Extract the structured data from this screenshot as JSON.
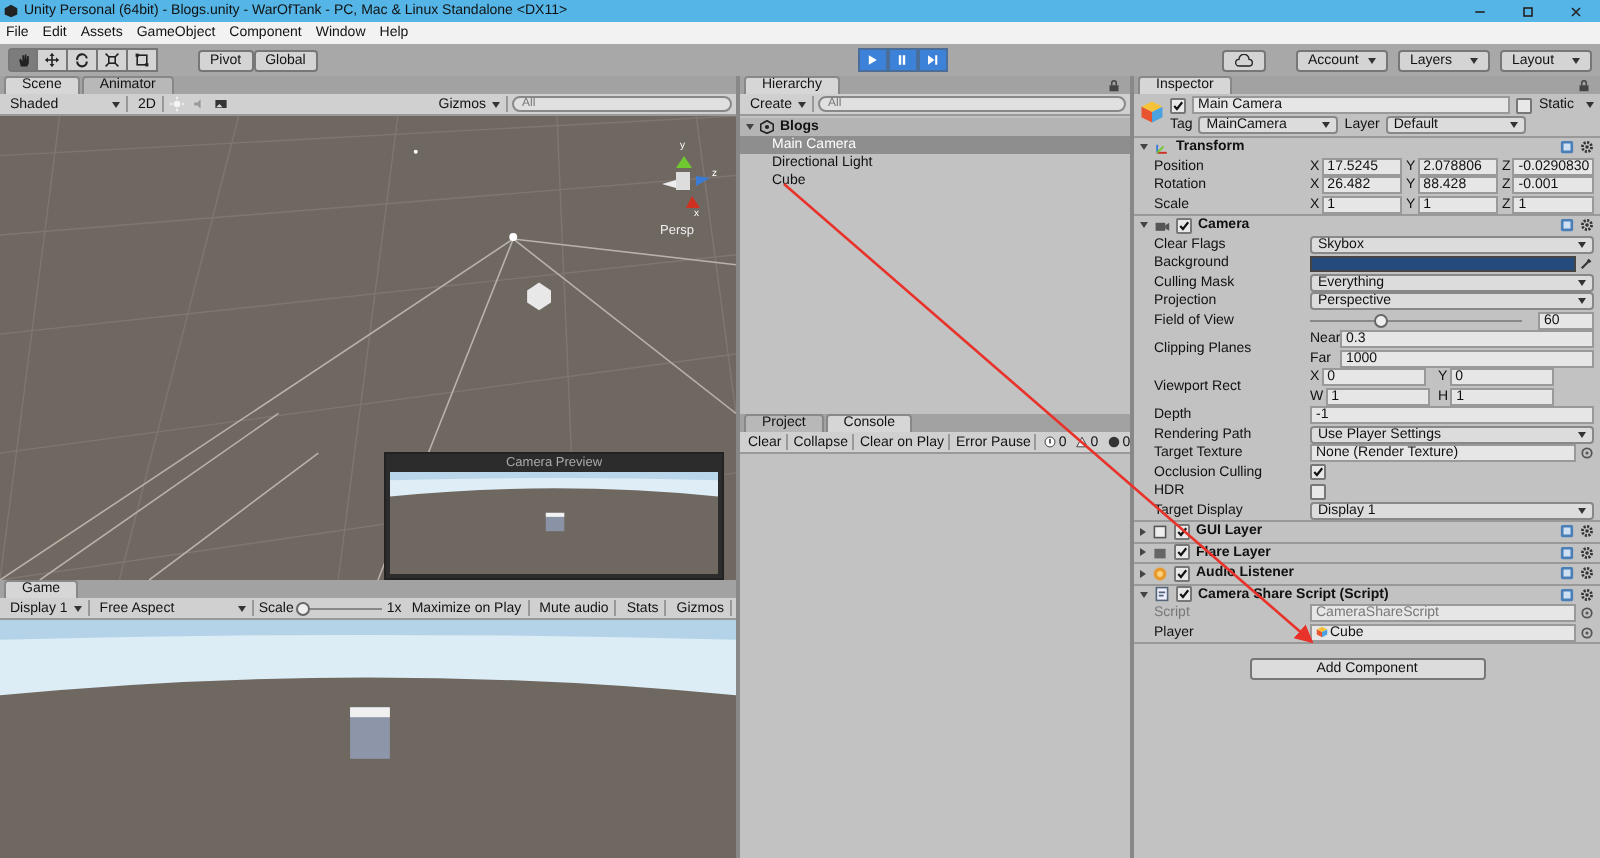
{
  "window": {
    "title": "Unity Personal (64bit) - Blogs.unity - WarOfTank - PC, Mac & Linux Standalone <DX11>"
  },
  "menu": [
    "File",
    "Edit",
    "Assets",
    "GameObject",
    "Component",
    "Window",
    "Help"
  ],
  "toolbar": {
    "tools": [
      {
        "kind": "hand",
        "selected": true
      },
      {
        "kind": "move",
        "selected": false
      },
      {
        "kind": "rotate",
        "selected": false
      },
      {
        "kind": "scale",
        "selected": false
      },
      {
        "kind": "rect",
        "selected": false
      }
    ],
    "pivot": "Pivot",
    "space": "Global",
    "playback": [
      {
        "kind": "play",
        "on": true
      },
      {
        "kind": "pause",
        "on": true
      },
      {
        "kind": "step",
        "on": true
      }
    ],
    "account": "Account",
    "layers": "Layers",
    "layout": "Layout"
  },
  "scene": {
    "tabs": [
      {
        "label": "Scene",
        "selected": true
      },
      {
        "label": "Animator",
        "selected": false
      }
    ],
    "shading": "Shaded",
    "mode_2d": "2D",
    "gizmos": "Gizmos",
    "search_placeholder": "All",
    "axes": [
      "y",
      "z",
      "x"
    ],
    "projection": "Persp",
    "camera_preview": {
      "title": "Camera Preview"
    }
  },
  "game": {
    "tab": "Game",
    "display": "Display 1",
    "aspect": "Free Aspect",
    "scale_label": "Scale",
    "scale": {
      "level": 0
    },
    "scale_reading": "1x",
    "buttons": [
      "Maximize on Play",
      "Mute audio",
      "Stats",
      "Gizmos"
    ]
  },
  "hierarchy": {
    "tab": "Hierarchy",
    "create": "Create",
    "search_placeholder": "All",
    "tree": [
      {
        "label": "Blogs",
        "expanded": true,
        "selected": false,
        "children": [
          {
            "label": "Main Camera",
            "selected": true
          },
          {
            "label": "Directional Light",
            "selected": false
          },
          {
            "label": "Cube",
            "selected": false
          }
        ]
      }
    ]
  },
  "console": {
    "tabs": [
      {
        "label": "Project",
        "selected": false
      },
      {
        "label": "Console",
        "selected": true
      }
    ],
    "buttons": [
      "Clear",
      "Collapse",
      "Clear on Play",
      "Error Pause"
    ],
    "counts": [
      {
        "kind": "info",
        "count": "0"
      },
      {
        "kind": "warning",
        "count": "0"
      },
      {
        "kind": "error",
        "count": "0"
      }
    ]
  },
  "inspector": {
    "tab": "Inspector",
    "active": true,
    "name": "Main Camera",
    "static_label": "Static",
    "static": false,
    "tag_label": "Tag",
    "tag": "MainCamera",
    "layer_label": "Layer",
    "layer": "Default",
    "components": [
      {
        "name": "Transform",
        "kind": "transform",
        "expanded": true,
        "rows": [
          {
            "kind": "vector",
            "label": "Position",
            "values": [
              {
                "axis": "X",
                "value": "17.5245"
              },
              {
                "axis": "Y",
                "value": "2.078806"
              },
              {
                "axis": "Z",
                "value": "-0.0290830"
              }
            ]
          },
          {
            "kind": "vector",
            "label": "Rotation",
            "values": [
              {
                "axis": "X",
                "value": "26.482"
              },
              {
                "axis": "Y",
                "value": "88.428"
              },
              {
                "axis": "Z",
                "value": "-0.001"
              }
            ]
          },
          {
            "kind": "vector",
            "label": "Scale",
            "values": [
              {
                "axis": "X",
                "value": "1"
              },
              {
                "axis": "Y",
                "value": "1"
              },
              {
                "axis": "Z",
                "value": "1"
              }
            ]
          }
        ]
      },
      {
        "name": "Camera",
        "kind": "camera",
        "enabled": true,
        "expanded": true,
        "rows": [
          {
            "kind": "dropdown",
            "label": "Clear Flags",
            "value": "Skybox"
          },
          {
            "kind": "color",
            "label": "Background",
            "color": "#254a7e"
          },
          {
            "kind": "dropdown",
            "label": "Culling Mask",
            "value": "Everything"
          },
          {
            "kind": "dropdown",
            "label": "Projection",
            "value": "Perspective"
          },
          {
            "kind": "slider",
            "label": "Field of View",
            "level": 0.33,
            "value": "60"
          },
          {
            "kind": "stacked",
            "label": "Clipping Planes",
            "values": [
              {
                "axis": "Near",
                "value": "0.3"
              },
              {
                "axis": "Far",
                "value": "1000"
              }
            ]
          },
          {
            "kind": "grid",
            "label": "Viewport Rect",
            "values": [
              {
                "axis": "X",
                "value": "0"
              },
              {
                "axis": "Y",
                "value": "0"
              },
              {
                "axis": "W",
                "value": "1"
              },
              {
                "axis": "H",
                "value": "1"
              }
            ]
          },
          {
            "kind": "text",
            "label": "Depth",
            "value": "-1"
          },
          {
            "kind": "dropdown",
            "label": "Rendering Path",
            "value": "Use Player Settings"
          },
          {
            "kind": "object",
            "label": "Target Texture",
            "value": "None (Render Texture)",
            "disabled": false,
            "has_icon": false
          },
          {
            "kind": "checkbox",
            "label": "Occlusion Culling",
            "checked": true
          },
          {
            "kind": "checkbox",
            "label": "HDR",
            "checked": false
          },
          {
            "kind": "dropdown",
            "label": "Target Display",
            "value": "Display 1"
          }
        ]
      },
      {
        "name": "GUI Layer",
        "kind": "gui_layer",
        "enabled": true,
        "expanded": false
      },
      {
        "name": "Flare Layer",
        "kind": "flare_layer",
        "enabled": true,
        "expanded": false
      },
      {
        "name": "Audio Listener",
        "kind": "audio_listener",
        "enabled": true,
        "expanded": false
      },
      {
        "name": "Camera Share Script (Script)",
        "kind": "script",
        "enabled": true,
        "expanded": true,
        "rows": [
          {
            "kind": "object",
            "label": "Script",
            "value": "CameraShareScript",
            "disabled": true,
            "has_icon": false
          },
          {
            "kind": "object",
            "label": "Player",
            "value": "Cube",
            "disabled": false,
            "has_icon": true
          }
        ]
      }
    ],
    "add_component": "Add Component"
  }
}
